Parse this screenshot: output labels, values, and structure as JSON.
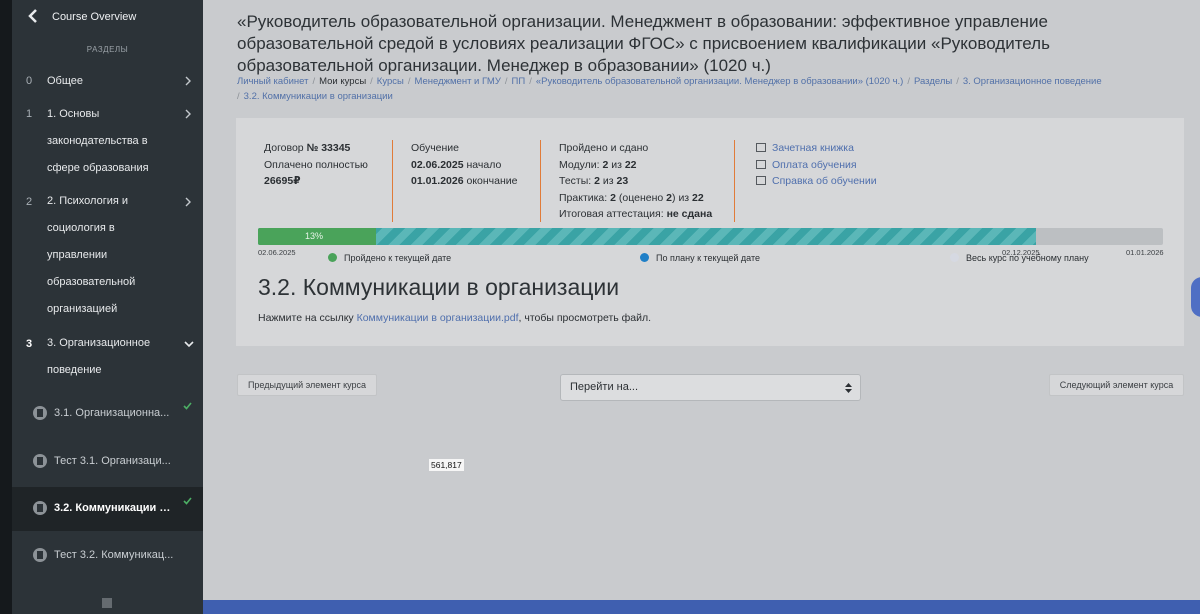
{
  "sidebar": {
    "header_title": "Course Overview",
    "section_label": "РАЗДЕЛЫ",
    "items": [
      {
        "num": "0",
        "lines": [
          "Общее"
        ]
      },
      {
        "num": "1",
        "lines": [
          "1. Основы",
          "законодательства в",
          "сфере образования"
        ]
      },
      {
        "num": "2",
        "lines": [
          "2. Психология и",
          "социология в",
          "управлении",
          "образовательной",
          "организацией"
        ]
      },
      {
        "num": "3",
        "lines": [
          "3. Организационное",
          "поведение"
        ]
      }
    ],
    "subitems": [
      {
        "label": "3.1. Организационна...",
        "done": true
      },
      {
        "label": "Тест 3.1. Организаци...",
        "done": false
      },
      {
        "label": "3.2. Коммуникации в ...",
        "done": true
      },
      {
        "label": "Тест 3.2. Коммуникац...",
        "done": false
      }
    ]
  },
  "page": {
    "title": "«Руководитель образовательной организации. Менеджмент в образовании: эффективное управление образовательной средой в условиях реализации ФГОС» с присвоением квалификации «Руководитель образовательной организации. Менеджер в образовании» (1020 ч.)",
    "breadcrumb": [
      {
        "text": "Личный кабинет",
        "link": true
      },
      {
        "text": "Мои курсы",
        "link": false
      },
      {
        "text": "Курсы",
        "link": true
      },
      {
        "text": "Менеджмент и ГМУ",
        "link": true
      },
      {
        "text": "ПП",
        "link": true
      },
      {
        "text": "«Руководитель образовательной организации. Менеджер в образовании» (1020 ч.)",
        "link": true
      },
      {
        "text": "Разделы",
        "link": true
      },
      {
        "text": "3. Организационное поведение",
        "link": true
      },
      {
        "text": "3.2. Коммуникации в организации",
        "link": true
      }
    ]
  },
  "contract": {
    "label": "Договор",
    "number": "№ 33345",
    "paid": "Оплачено полностью",
    "amount": "26695₽"
  },
  "study": {
    "label": "Обучение",
    "start_date": "02.06.2025",
    "start_word": "начало",
    "end_date": "01.01.2026",
    "end_word": "окончание"
  },
  "passed": {
    "label": "Пройдено и сдано",
    "modules_label": "Модули:",
    "modules_done": "2",
    "modules_total": "22",
    "tests_label": "Тесты:",
    "tests_done": "2",
    "tests_total": "23",
    "practice_label": "Практика:",
    "practice_done": "2",
    "practice_graded_label": "(оценено",
    "practice_graded": "2",
    "practice_total": "22",
    "of": "из",
    "final_label": "Итоговая аттестация:",
    "final_value": "не сдана"
  },
  "links": [
    "Зачетная книжка",
    "Оплата обучения",
    "Справка об обучении"
  ],
  "progress": {
    "percent_label": "13%",
    "done_fraction": 0.13,
    "plan_fraction": 0.86,
    "date_start": "02.06.2025",
    "date_plan": "02.12.2025",
    "date_end": "01.01.2026",
    "legend_done": "Пройдено к текущей дате",
    "legend_plan": "По плану к текущей дате",
    "legend_all": "Весь курс по учебному плану",
    "colors": {
      "done": "#4aa35a",
      "plan": "#1f7fc7",
      "all": "#d6d9e2"
    }
  },
  "content": {
    "heading": "3.2. Коммуникации в организации",
    "text_before": "Нажмите на ссылку ",
    "link_text": "Коммуникации в организации.pdf",
    "text_after": ", чтобы просмотреть файл."
  },
  "nav": {
    "prev": "Предыдущий элемент курса",
    "jump": "Перейти на...",
    "next": "Следующий элемент курса"
  },
  "overlay": {
    "coords": "561,817"
  }
}
